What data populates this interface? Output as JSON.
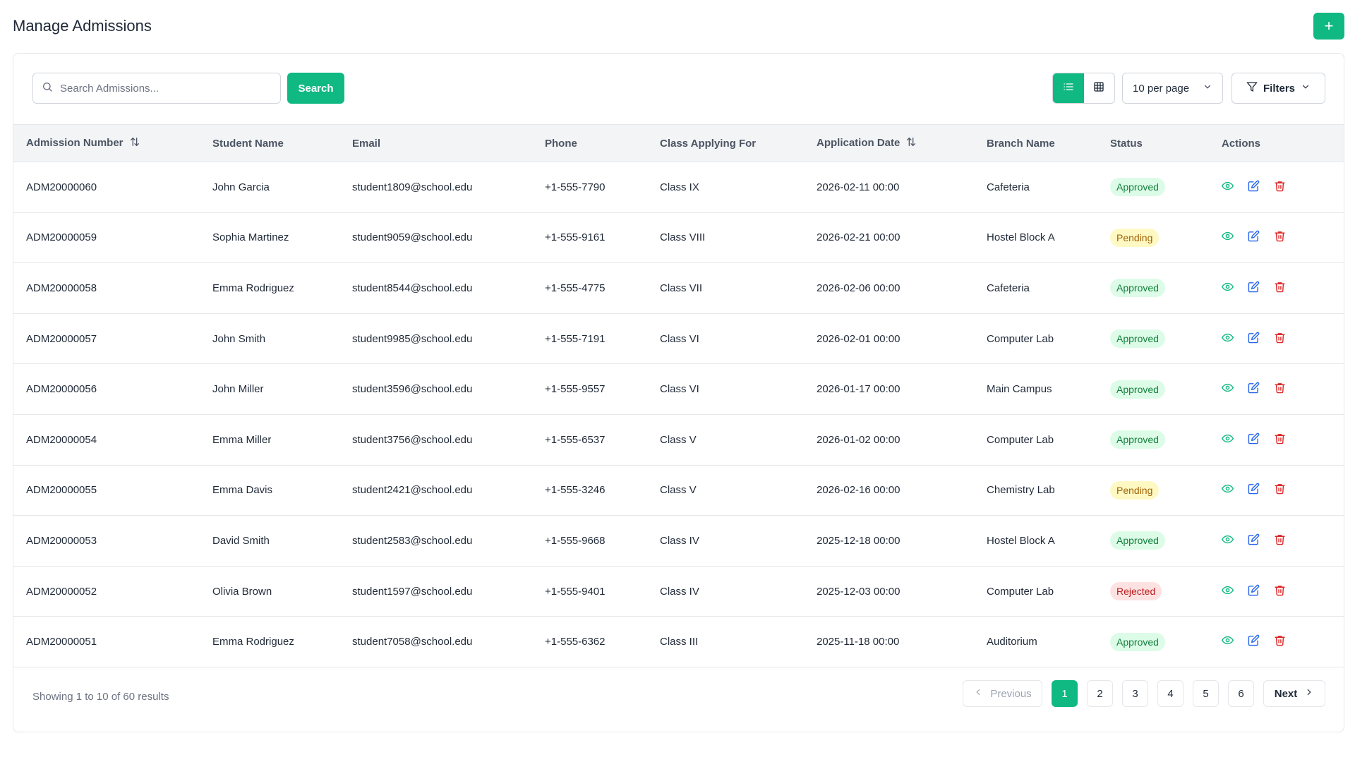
{
  "header": {
    "title": "Manage Admissions",
    "add_label": "+"
  },
  "toolbar": {
    "search_placeholder": "Search Admissions...",
    "search_value": "",
    "search_button": "Search",
    "per_page": "10 per page",
    "filters": "Filters"
  },
  "table": {
    "columns": [
      "Admission Number",
      "Student Name",
      "Email",
      "Phone",
      "Class Applying For",
      "Application Date",
      "Branch Name",
      "Status",
      "Actions"
    ],
    "rows": [
      [
        "ADM20000060",
        "John Garcia",
        "student1809@school.edu",
        "+1-555-7790",
        "Class IX",
        "2026-02-11 00:00",
        "Cafeteria",
        "Approved"
      ],
      [
        "ADM20000059",
        "Sophia Martinez",
        "student9059@school.edu",
        "+1-555-9161",
        "Class VIII",
        "2026-02-21 00:00",
        "Hostel Block A",
        "Pending"
      ],
      [
        "ADM20000058",
        "Emma Rodriguez",
        "student8544@school.edu",
        "+1-555-4775",
        "Class VII",
        "2026-02-06 00:00",
        "Cafeteria",
        "Approved"
      ],
      [
        "ADM20000057",
        "John Smith",
        "student9985@school.edu",
        "+1-555-7191",
        "Class VI",
        "2026-02-01 00:00",
        "Computer Lab",
        "Approved"
      ],
      [
        "ADM20000056",
        "John Miller",
        "student3596@school.edu",
        "+1-555-9557",
        "Class VI",
        "2026-01-17 00:00",
        "Main Campus",
        "Approved"
      ],
      [
        "ADM20000054",
        "Emma Miller",
        "student3756@school.edu",
        "+1-555-6537",
        "Class V",
        "2026-01-02 00:00",
        "Computer Lab",
        "Approved"
      ],
      [
        "ADM20000055",
        "Emma Davis",
        "student2421@school.edu",
        "+1-555-3246",
        "Class V",
        "2026-02-16 00:00",
        "Chemistry Lab",
        "Pending"
      ],
      [
        "ADM20000053",
        "David Smith",
        "student2583@school.edu",
        "+1-555-9668",
        "Class IV",
        "2025-12-18 00:00",
        "Hostel Block A",
        "Approved"
      ],
      [
        "ADM20000052",
        "Olivia Brown",
        "student1597@school.edu",
        "+1-555-9401",
        "Class IV",
        "2025-12-03 00:00",
        "Computer Lab",
        "Rejected"
      ],
      [
        "ADM20000051",
        "Emma Rodriguez",
        "student7058@school.edu",
        "+1-555-6362",
        "Class III",
        "2025-11-18 00:00",
        "Auditorium",
        "Approved"
      ]
    ]
  },
  "footer": {
    "showing": "Showing 1 to 10 of 60 results",
    "previous": "Previous",
    "next": "Next",
    "pages": [
      "1",
      "2",
      "3",
      "4",
      "5",
      "6"
    ],
    "current_page": "1"
  },
  "colors": {
    "accent": "#10b981",
    "view": "#10b981",
    "edit": "#2563eb",
    "delete": "#dc2626"
  },
  "icons": {
    "search": "search-icon",
    "list": "list-icon",
    "grid": "grid-icon",
    "filter": "filter-icon",
    "view": "eye-icon",
    "edit": "edit-icon",
    "delete": "trash-icon"
  }
}
